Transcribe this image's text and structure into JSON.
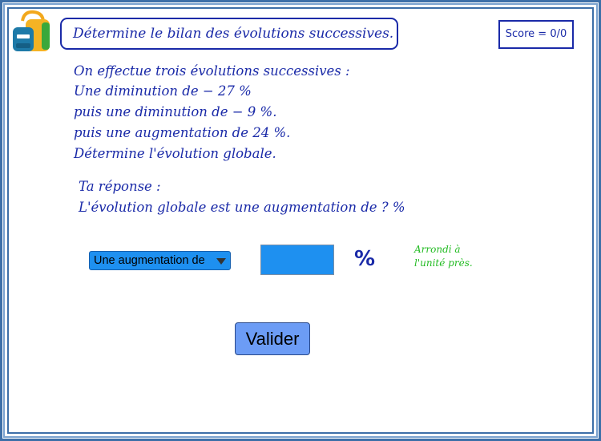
{
  "header": {
    "title": "Détermine le bilan des évolutions successives.",
    "score": "Score = 0/0"
  },
  "problem": {
    "lines": [
      "On effectue trois évolutions successives :",
      "Une diminution de  − 27 %",
      "puis une diminution de  − 9 %.",
      "puis une augmentation de 24 %.",
      "Détermine l'évolution globale."
    ]
  },
  "answer": {
    "label": "Ta réponse :",
    "sentence": "L'évolution globale est une augmentation de ? %",
    "dropdown_value": "Une augmentation de",
    "input_value": "",
    "percent_symbol": "%",
    "hint_line1": "Arrondi à",
    "hint_line2": "l'unité près."
  },
  "actions": {
    "submit_label": "Valider"
  },
  "colors": {
    "text_blue": "#1a2aa8",
    "control_blue": "#1e90f0",
    "button_blue": "#6c9cf5",
    "hint_green": "#22bb22",
    "frame_blue": "#3d6fa8"
  }
}
